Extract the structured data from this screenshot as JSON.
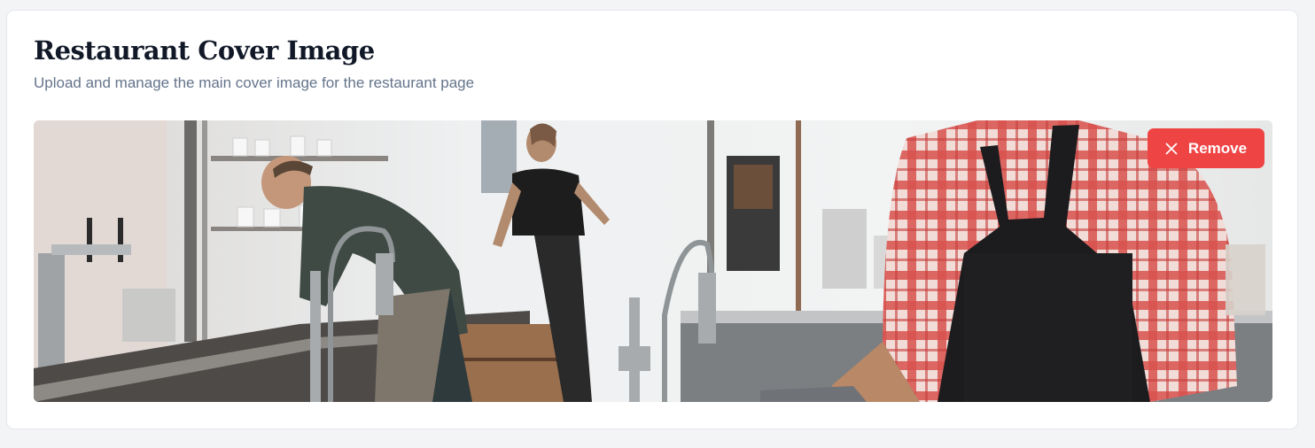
{
  "card": {
    "title": "Restaurant Cover Image",
    "subtitle": "Upload and manage the main cover image for the restaurant page"
  },
  "cover_image": {
    "alt": "Restaurant cover image",
    "remove_label": "Remove",
    "remove_icon": "close-icon"
  },
  "colors": {
    "danger": "#ef4444",
    "title": "#111827",
    "subtitle": "#64748b",
    "page_background": "#f3f4f6"
  }
}
